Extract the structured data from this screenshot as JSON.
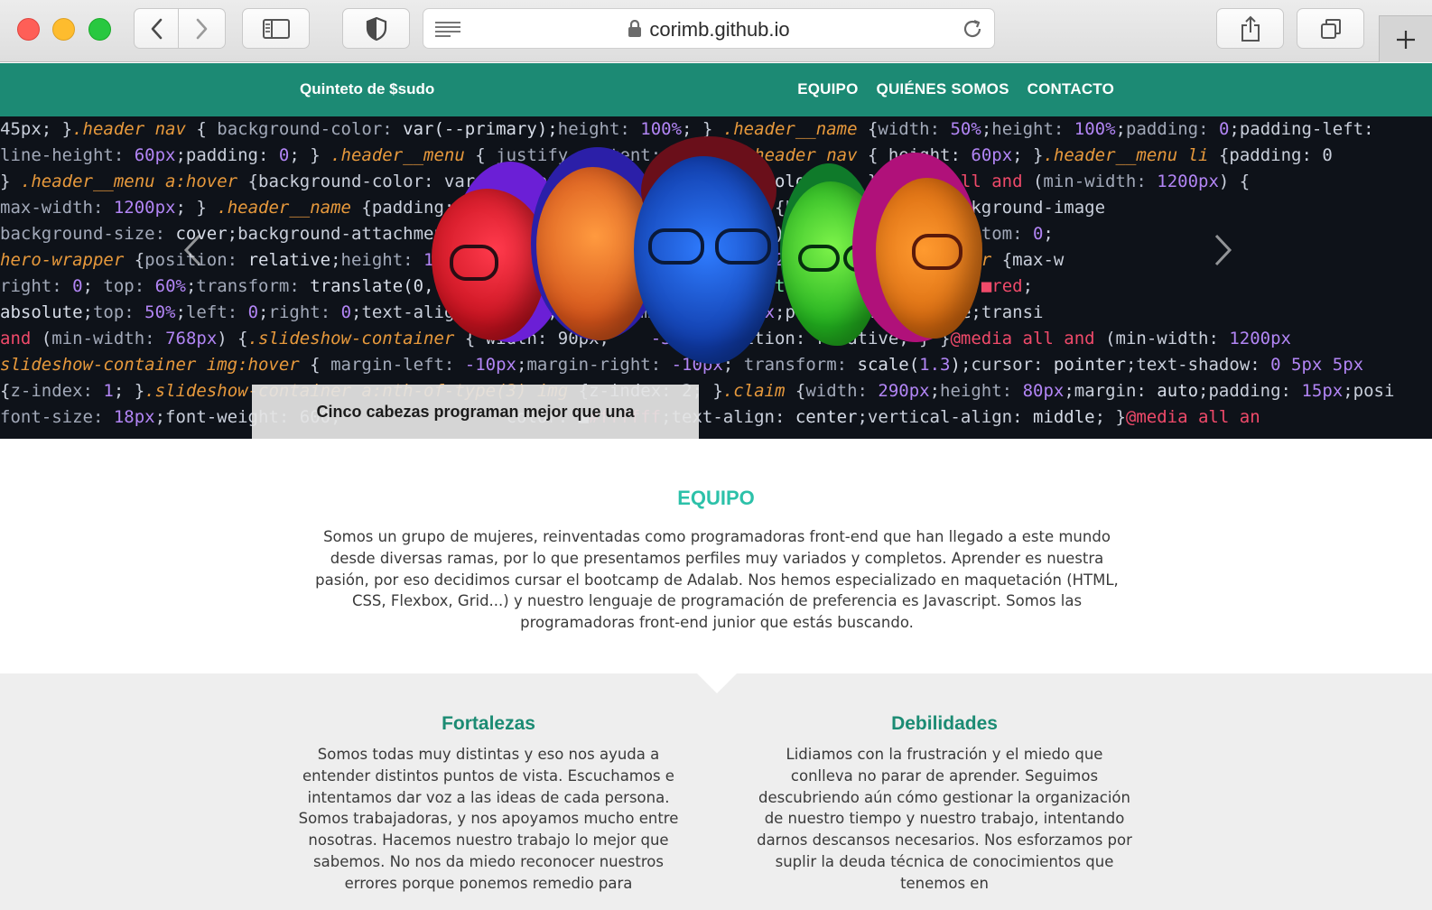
{
  "browser": {
    "url": "corimb.github.io",
    "icons": [
      "back-icon",
      "forward-icon",
      "sidebar-icon",
      "shield-icon",
      "reader-icon",
      "lock-icon",
      "reload-icon",
      "share-icon",
      "tabs-icon",
      "plus-icon"
    ]
  },
  "header": {
    "brand": "Quinteto de $sudo",
    "menu": [
      "EQUIPO",
      "QUIÉNES SOMOS",
      "CONTACTO"
    ],
    "color": "#1c8a74"
  },
  "hero": {
    "claim": "Cinco cabezas programan mejor que una"
  },
  "team": {
    "title": "EQUIPO",
    "description": "Somos un grupo de mujeres, reinventadas como programadoras front-end que han llegado a este mundo desde diversas ramas, por lo que presentamos perfiles muy variados y completos. Aprender es nuestra pasión, por eso decidimos cursar el bootcamp de Adalab. Nos hemos especializado en maquetación (HTML, CSS, Flexbox, Grid...) y nuestro lenguaje de programación de preferencia es Javascript. Somos las programadoras front-end junior que estás buscando."
  },
  "strengths": {
    "title": "Fortalezas",
    "text": "Somos todas muy distintas y eso nos ayuda a entender distintos puntos de vista. Escuchamos e intentamos dar voz a las ideas de cada persona. Somos trabajadoras, y nos apoyamos mucho entre nosotras. Hacemos nuestro trabajo lo mejor que sabemos. No nos da miedo reconocer nuestros errores porque ponemos remedio para"
  },
  "weaknesses": {
    "title": "Debilidades",
    "text": "Lidiamos con la frustración y el miedo que conlleva no parar de aprender. Seguimos descubriendo aún cómo gestionar la organización de nuestro tiempo y nuestro trabajo, intentando darnos descansos necesarios. Nos esforzamos por suplir la deuda técnica de conocimientos que tenemos en"
  },
  "colors": {
    "accent": "#2cc1a9",
    "heading": "#1b8b73",
    "section_bg": "#eeeeee"
  }
}
